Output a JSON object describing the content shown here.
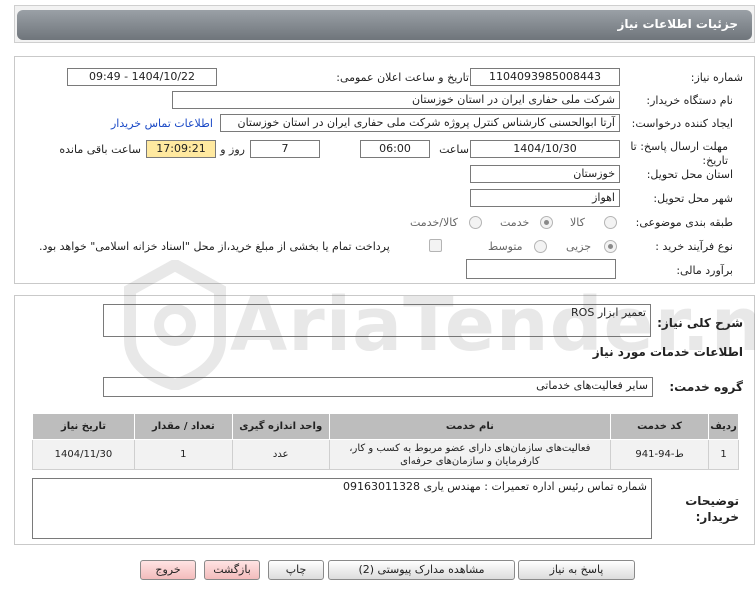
{
  "header": {
    "title": "جزئیات اطلاعات نیاز"
  },
  "form": {
    "need_number_label": "شماره نیاز:",
    "need_number": "1104093985008443",
    "announce_label": "تاریخ و ساعت اعلان عمومی:",
    "announce_value": "1404/10/22 - 09:49",
    "buyer_label": "نام دستگاه خریدار:",
    "buyer_value": "شرکت ملی حفاری ایران در استان خوزستان",
    "creator_label": "ایجاد کننده درخواست:",
    "creator_value": "آرتا ابوالحسنی کارشناس کنترل پروژه شرکت ملی حفاری ایران در استان خوزستان",
    "contact_link": "اطلاعات تماس خریدار",
    "deadline_label_1": "مهلت ارسال پاسخ: تا",
    "deadline_label_2": "تاریخ:",
    "deadline_date": "1404/10/30",
    "time_label": "ساعت",
    "deadline_time": "06:00",
    "days_value": "7",
    "days_label": "روز و",
    "remaining_time": "17:09:21",
    "remaining_label": "ساعت باقی مانده",
    "province_label": "استان محل تحویل:",
    "province_value": "خوزستان",
    "city_label": "شهر محل تحویل:",
    "city_value": "اهواز",
    "category_label": "طبقه بندی موضوعی:",
    "category_options": [
      "کالا",
      "خدمت",
      "کالا/خدمت"
    ],
    "category_selected": "خدمت",
    "process_label": "نوع فرآیند خرید :",
    "process_options": [
      "جزیی",
      "متوسط"
    ],
    "process_selected": "جزیی",
    "payment_note": "پرداخت تمام یا بخشی از مبلغ خرید،از محل \"اسناد خزانه اسلامی\" خواهد بود.",
    "budget_label": "برآورد مالی:",
    "budget_value": ""
  },
  "summary": {
    "label": "شرح کلی نیاز:",
    "value": "تعمیر ابزار ROS"
  },
  "services": {
    "section_title": "اطلاعات خدمات مورد نیاز",
    "group_label": "گروه خدمت:",
    "group_value": "سایر فعالیت‌های خدماتی",
    "table": {
      "headers": [
        "ردیف",
        "کد خدمت",
        "نام خدمت",
        "واحد اندازه گیری",
        "تعداد / مقدار",
        "تاریخ نیاز"
      ],
      "rows": [
        [
          "1",
          "ط-94-941",
          "فعالیت‌های سازمان‌های دارای عضو مربوط به کسب و کار، کارفرمایان و سازمان‌های حرفه‌ای",
          "عدد",
          "1",
          "1404/11/30"
        ]
      ]
    }
  },
  "buyer_notes": {
    "label_1": "توضیحات",
    "label_2": "خریدار:",
    "value": "شماره تماس رئیس اداره تعمیرات :  مهندس یاری 09163011328"
  },
  "buttons": {
    "reply": "پاسخ به نیاز",
    "view_docs": "مشاهده مدارک پیوستی (2)",
    "print": "چاپ",
    "back": "بازگشت",
    "exit": "خروج"
  },
  "watermark": {
    "text": "AriaTender.neT"
  },
  "colors": {
    "header_bg": "#6f757b",
    "remaining_bg": "#ffe9a0",
    "link": "#1a49c6",
    "table_header": "#bdbdbd"
  }
}
